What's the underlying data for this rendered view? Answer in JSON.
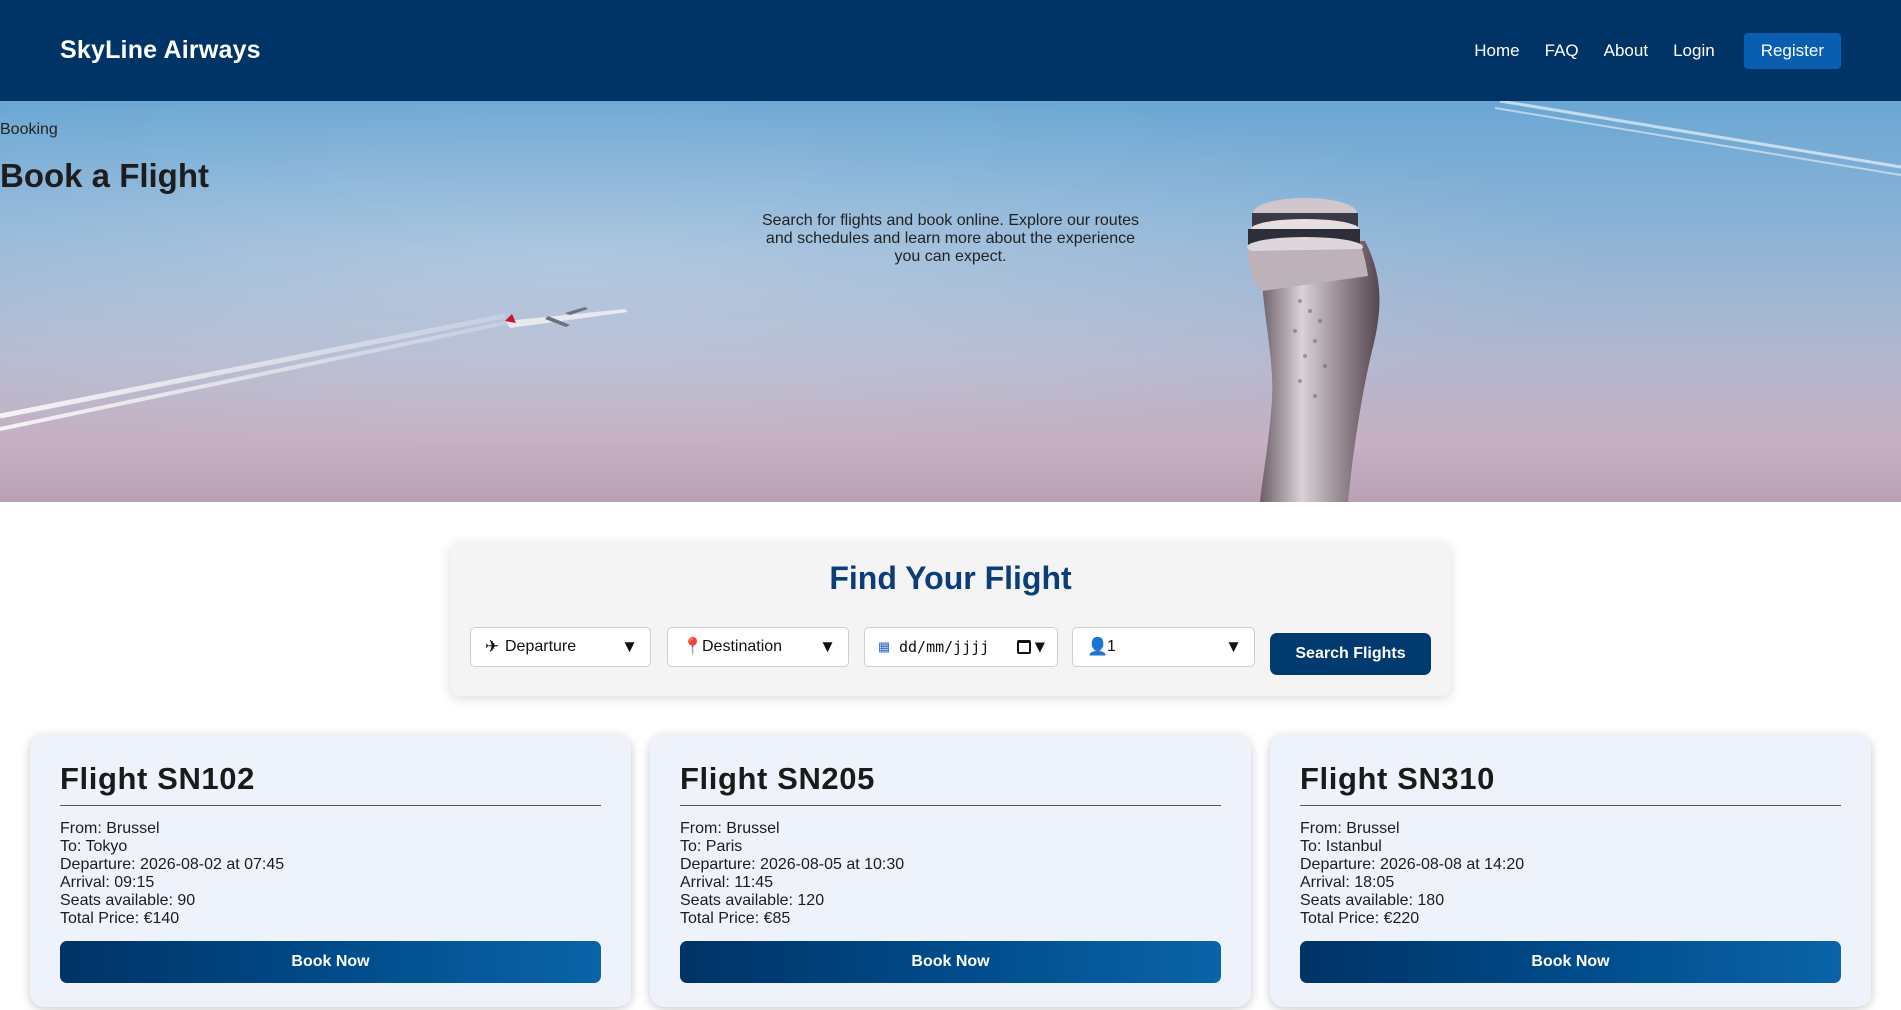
{
  "header": {
    "brand": "SkyLine Airways",
    "nav": [
      "Home",
      "FAQ",
      "About",
      "Login"
    ],
    "register": "Register"
  },
  "hero": {
    "eyebrow": "Booking",
    "title": "Book a Flight",
    "description": "Search for flights and book online. Explore our routes and schedules and learn more about the experience you can expect."
  },
  "search": {
    "title": "Find Your Flight",
    "departure": {
      "icon": "airplane-icon",
      "label": "Departure"
    },
    "destination": {
      "icon": "pin-icon",
      "label": "Destination"
    },
    "date": {
      "placeholder": "dd/mm/jjjj"
    },
    "passengers": {
      "icon": "person-icon",
      "value": "1"
    },
    "button": "Search Flights"
  },
  "flights": [
    {
      "title": "Flight SN102",
      "from": "From: Brussel",
      "to": "To: Tokyo",
      "departure": "Departure: 2026-08-02 at 07:45",
      "arrival": "Arrival: 09:15",
      "seats": "Seats available: 90",
      "price": "Total Price: €140",
      "button": "Book Now"
    },
    {
      "title": "Flight SN205",
      "from": "From: Brussel",
      "to": "To: Paris",
      "departure": "Departure: 2026-08-05 at 10:30",
      "arrival": "Arrival: 11:45",
      "seats": "Seats available: 120",
      "price": "Total Price: €85",
      "button": "Book Now"
    },
    {
      "title": "Flight SN310",
      "from": "From: Brussel",
      "to": "To: Istanbul",
      "departure": "Departure: 2026-08-08 at 14:20",
      "arrival": "Arrival: 18:05",
      "seats": "Seats available: 180",
      "price": "Total Price: €220",
      "button": "Book Now"
    }
  ],
  "colors": {
    "header": "#003366",
    "accent": "#0a5eb0",
    "title": "#0b3d79",
    "card": "#eef3fb"
  }
}
